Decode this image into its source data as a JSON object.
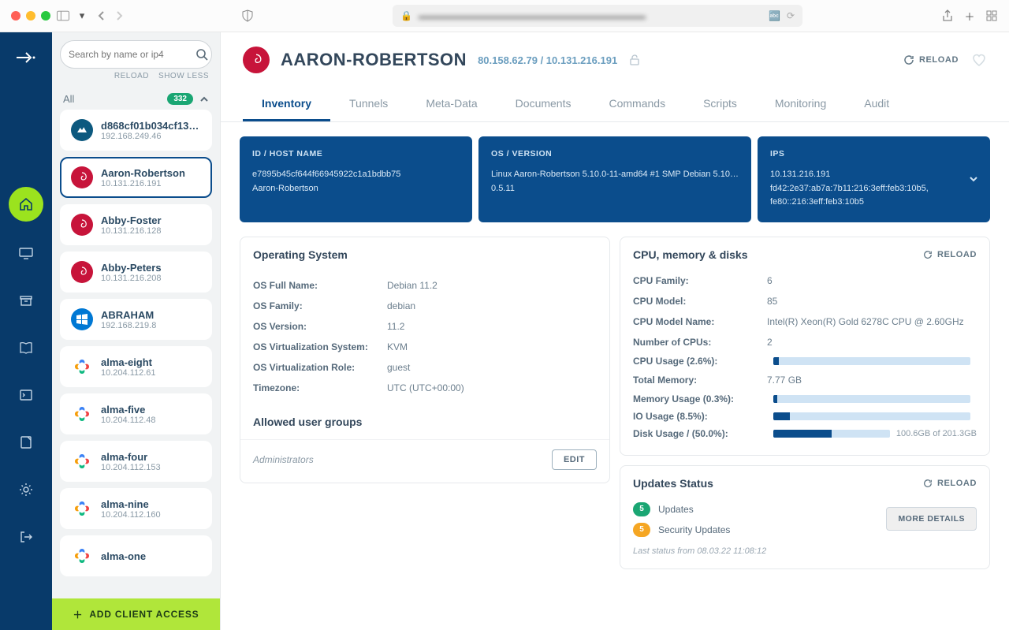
{
  "browser": {
    "placeholder_blur": "▬▬▬▬▬▬▬▬▬▬▬▬▬▬▬▬▬▬▬▬▬▬▬▬"
  },
  "sidebar": {
    "search_placeholder": "Search by name or ip4",
    "reload_label": "RELOAD",
    "show_less_label": "SHOW LESS",
    "all_label": "All",
    "all_count": "332",
    "items": [
      {
        "name": "d868cf01b034cf132f…",
        "ip": "192.168.249.46",
        "os": "alpine"
      },
      {
        "name": "Aaron-Robertson",
        "ip": "10.131.216.191",
        "os": "debian"
      },
      {
        "name": "Abby-Foster",
        "ip": "10.131.216.128",
        "os": "debian"
      },
      {
        "name": "Abby-Peters",
        "ip": "10.131.216.208",
        "os": "debian"
      },
      {
        "name": "ABRAHAM",
        "ip": "192.168.219.8",
        "os": "windows"
      },
      {
        "name": "alma-eight",
        "ip": "10.204.112.61",
        "os": "alma"
      },
      {
        "name": "alma-five",
        "ip": "10.204.112.48",
        "os": "alma"
      },
      {
        "name": "alma-four",
        "ip": "10.204.112.153",
        "os": "alma"
      },
      {
        "name": "alma-nine",
        "ip": "10.204.112.160",
        "os": "alma"
      },
      {
        "name": "alma-one",
        "ip": "",
        "os": "alma"
      }
    ],
    "add_client_label": "ADD CLIENT ACCESS"
  },
  "header": {
    "title": "AARON-ROBERTSON",
    "ips": "80.158.62.79 / 10.131.216.191",
    "reload_label": "RELOAD"
  },
  "tabs": [
    "Inventory",
    "Tunnels",
    "Meta-Data",
    "Documents",
    "Commands",
    "Scripts",
    "Monitoring",
    "Audit"
  ],
  "cards": {
    "id": {
      "title": "ID / HOST NAME",
      "line1": "e7895b45cf644f66945922c1a1bdbb75",
      "line2": "Aaron-Robertson"
    },
    "os": {
      "title": "OS / VERSION",
      "line1": "Linux Aaron-Robertson 5.10.0-11-amd64 #1 SMP Debian 5.10…",
      "line2": "0.5.11"
    },
    "ips": {
      "title": "IPS",
      "line1": "10.131.216.191",
      "line2": "fd42:2e37:ab7a:7b11:216:3eff:feb3:10b5, fe80::216:3eff:feb3:10b5"
    }
  },
  "os_card": {
    "title": "Operating System",
    "rows": [
      {
        "k": "OS Full Name:",
        "v": "Debian 11.2"
      },
      {
        "k": "OS Family:",
        "v": "debian"
      },
      {
        "k": "OS Version:",
        "v": "11.2"
      },
      {
        "k": "OS Virtualization System:",
        "v": "KVM"
      },
      {
        "k": "OS Virtualization Role:",
        "v": "guest"
      },
      {
        "k": "Timezone:",
        "v": "UTC (UTC+00:00)"
      }
    ],
    "allowed_title": "Allowed user groups",
    "allowed_value": "Administrators",
    "edit_label": "EDIT"
  },
  "cpu_card": {
    "title": "CPU, memory & disks",
    "reload_label": "RELOAD",
    "rows": [
      {
        "k": "CPU Family:",
        "v": "6"
      },
      {
        "k": "CPU Model:",
        "v": "85"
      },
      {
        "k": "CPU Model Name:",
        "v": "Intel(R) Xeon(R) Gold 6278C CPU @ 2.60GHz"
      },
      {
        "k": "Number of CPUs:",
        "v": "2"
      }
    ],
    "bars": [
      {
        "k": "CPU Usage (2.6%):",
        "pct": 2.6,
        "extra": ""
      },
      {
        "k": "Total Memory:",
        "v": "7.77 GB"
      },
      {
        "k": "Memory Usage (0.3%):",
        "pct": 0.3,
        "extra": ""
      },
      {
        "k": "IO Usage (8.5%):",
        "pct": 8.5,
        "extra": ""
      },
      {
        "k": "Disk Usage / (50.0%):",
        "pct": 50.0,
        "extra": "100.6GB of 201.3GB"
      }
    ]
  },
  "updates_card": {
    "title": "Updates Status",
    "reload_label": "RELOAD",
    "updates_count": "5",
    "updates_label": "Updates",
    "security_count": "5",
    "security_label": "Security Updates",
    "more_label": "MORE DETAILS",
    "status_text": "Last status from 08.03.22 11:08:12"
  }
}
